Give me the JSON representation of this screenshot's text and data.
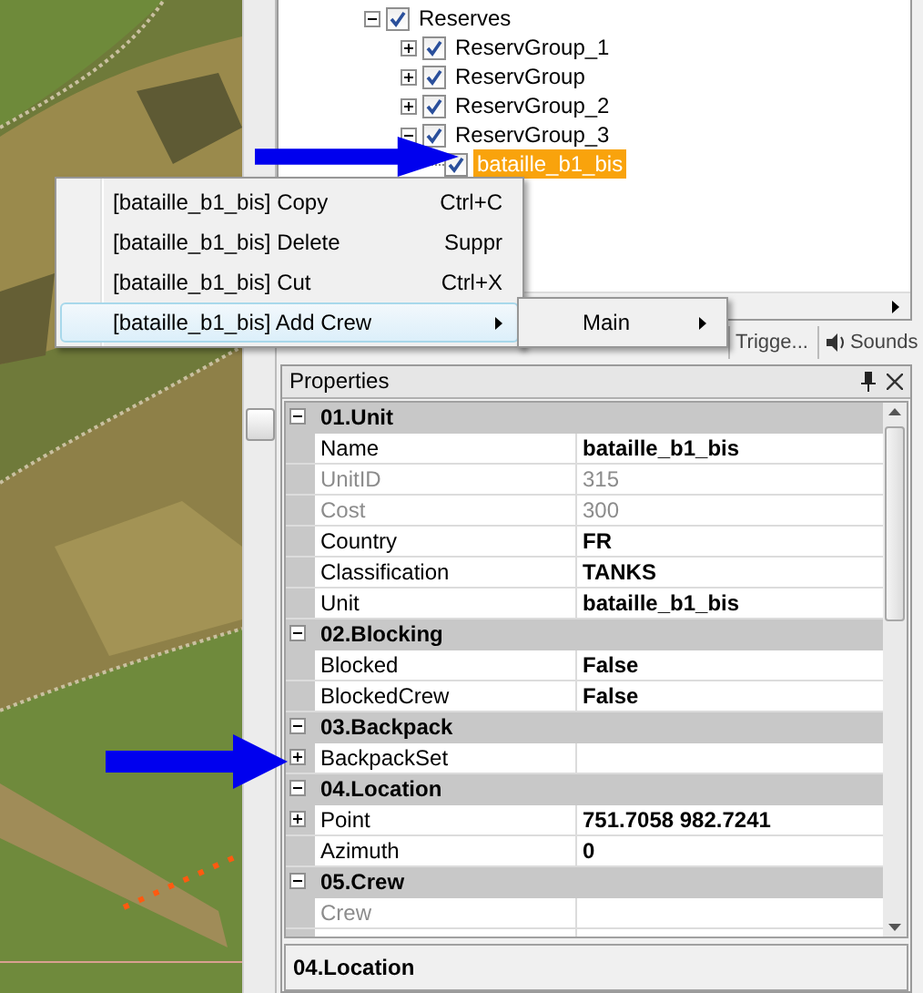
{
  "tree": {
    "items": [
      {
        "label": "Reserves",
        "checked": true,
        "expanded": true,
        "selected": false,
        "children": [
          {
            "label": "ReservGroup_1",
            "checked": true,
            "expanded": false,
            "selected": false
          },
          {
            "label": "ReservGroup",
            "checked": true,
            "expanded": false,
            "selected": false
          },
          {
            "label": "ReservGroup_2",
            "checked": true,
            "expanded": false,
            "selected": false
          },
          {
            "label": "ReservGroup_3",
            "checked": true,
            "expanded": true,
            "selected": false,
            "children": [
              {
                "label": "bataille_b1_bis",
                "checked": true,
                "selected": true
              }
            ]
          }
        ]
      }
    ]
  },
  "tabs": [
    {
      "label": "Trigge...",
      "selected": false
    },
    {
      "label": "Sounds",
      "selected": false
    }
  ],
  "context_menu": {
    "items": [
      {
        "label": "[bataille_b1_bis] Copy",
        "shortcut": "Ctrl+C",
        "selected": false,
        "has_submenu": false
      },
      {
        "label": "[bataille_b1_bis] Delete",
        "shortcut": "Suppr",
        "selected": false,
        "has_submenu": false
      },
      {
        "label": "[bataille_b1_bis] Cut",
        "shortcut": "Ctrl+X",
        "selected": false,
        "has_submenu": false
      },
      {
        "label": "[bataille_b1_bis] Add Crew",
        "selected": true,
        "has_submenu": true
      }
    ],
    "submenu": [
      {
        "label": "Main",
        "selected": false,
        "has_submenu": true
      }
    ]
  },
  "properties": {
    "title": "Properties",
    "rows": [
      {
        "kind": "category",
        "name": "01.Unit",
        "expanded": true
      },
      {
        "kind": "property",
        "name": "Name",
        "value": "bataille_b1_bis",
        "readonly": false
      },
      {
        "kind": "property",
        "name": "UnitID",
        "value": "315",
        "readonly": true
      },
      {
        "kind": "property",
        "name": "Cost",
        "value": "300",
        "readonly": true
      },
      {
        "kind": "property",
        "name": "Country",
        "value": "FR",
        "readonly": false
      },
      {
        "kind": "property",
        "name": "Classification",
        "value": "TANKS",
        "readonly": false
      },
      {
        "kind": "property",
        "name": "Unit",
        "value": "bataille_b1_bis",
        "readonly": false
      },
      {
        "kind": "category",
        "name": "02.Blocking",
        "expanded": true
      },
      {
        "kind": "property",
        "name": "Blocked",
        "value": "False",
        "readonly": false
      },
      {
        "kind": "property",
        "name": "BlockedCrew",
        "value": "False",
        "readonly": false
      },
      {
        "kind": "category",
        "name": "03.Backpack",
        "expanded": true
      },
      {
        "kind": "property",
        "name": "BackpackSet",
        "readonly": false,
        "expandable": true,
        "expanded": false
      },
      {
        "kind": "category",
        "name": "04.Location",
        "expanded": true
      },
      {
        "kind": "property",
        "name": "Point",
        "value": "751.7058 982.7241",
        "readonly": false,
        "expandable": true,
        "expanded": false
      },
      {
        "kind": "property",
        "name": "Azimuth",
        "value": "0",
        "readonly": false
      },
      {
        "kind": "category",
        "name": "05.Crew",
        "expanded": true
      },
      {
        "kind": "property",
        "name": "Crew",
        "readonly": true
      },
      {
        "kind": "property"
      }
    ],
    "description": "04.Location"
  }
}
